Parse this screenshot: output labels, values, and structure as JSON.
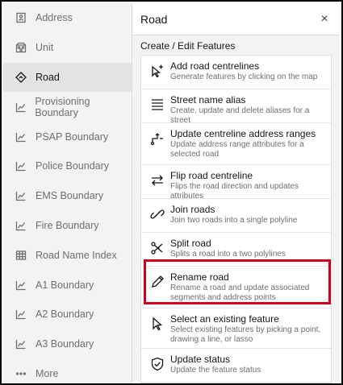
{
  "sidebar": {
    "items": [
      {
        "label": "Address",
        "icon": "address-icon",
        "active": false
      },
      {
        "label": "Unit",
        "icon": "unit-icon",
        "active": false
      },
      {
        "label": "Road",
        "icon": "road-icon",
        "active": true
      },
      {
        "label": "Provisioning Boundary",
        "icon": "boundary-icon",
        "active": false
      },
      {
        "label": "PSAP Boundary",
        "icon": "boundary-icon",
        "active": false
      },
      {
        "label": "Police Boundary",
        "icon": "boundary-icon",
        "active": false
      },
      {
        "label": "EMS Boundary",
        "icon": "boundary-icon",
        "active": false
      },
      {
        "label": "Fire Boundary",
        "icon": "boundary-icon",
        "active": false
      },
      {
        "label": "Road Name Index",
        "icon": "table-icon",
        "active": false
      },
      {
        "label": "A1 Boundary",
        "icon": "boundary-icon",
        "active": false
      },
      {
        "label": "A2 Boundary",
        "icon": "boundary-icon",
        "active": false
      },
      {
        "label": "A3 Boundary",
        "icon": "boundary-icon",
        "active": false
      },
      {
        "label": "More",
        "icon": "more-icon",
        "active": false
      }
    ]
  },
  "panel": {
    "title": "Road",
    "close_label": "×",
    "section_title": "Create / Edit Features",
    "cards": [
      {
        "title": "Add road centrelines",
        "desc": "Generate features by clicking on the map",
        "icon": "add-cursor-icon"
      },
      {
        "title": "Street name alias",
        "desc": "Create, update and delete aliases for a street",
        "icon": "list-icon"
      },
      {
        "title": "Update centreline address ranges",
        "desc": "Update address range attributes for a selected road",
        "icon": "range-icon"
      },
      {
        "title": "Flip road centreline",
        "desc": "Flips the road direction and updates attributes",
        "icon": "flip-icon"
      },
      {
        "title": "Join roads",
        "desc": "Join two roads into a single polyline",
        "icon": "join-icon"
      },
      {
        "title": "Split road",
        "desc": "Splits a road into a two polylines",
        "icon": "split-icon"
      },
      {
        "title": "Rename road",
        "desc": "Rename a road and update associated segments and address points",
        "icon": "pencil-icon"
      },
      {
        "title": "Select an existing feature",
        "desc": "Select existing features by picking a point, drawing a line, or lasso",
        "icon": "select-cursor-icon"
      }
    ],
    "status_card": {
      "title": "Update status",
      "desc": "Update the feature status",
      "icon": "shield-check-icon"
    }
  },
  "colors": {
    "highlight": "#d0021b",
    "sidebar_bg": "#f3f3f3",
    "active_bg": "#e3e3e3"
  }
}
